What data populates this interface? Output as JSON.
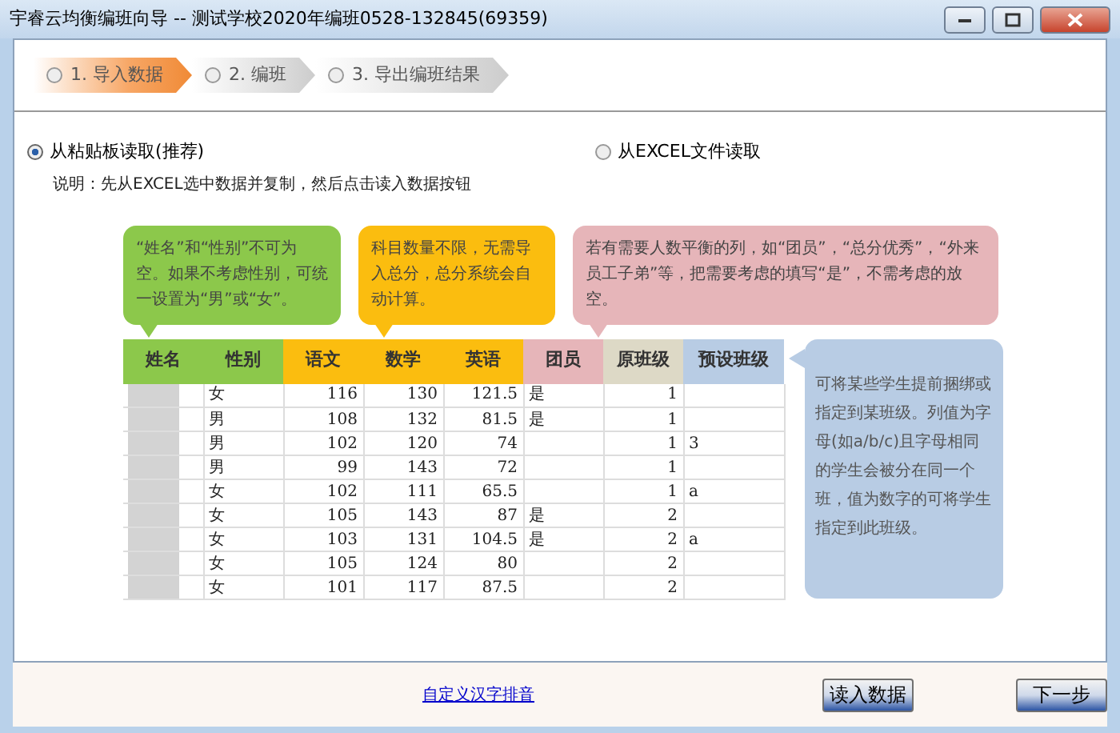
{
  "window": {
    "title": "宇睿云均衡编班向导 -- 测试学校2020年编班0528-132845(69359)"
  },
  "steps": [
    {
      "number": "1.",
      "label": "导入数据",
      "selected": true
    },
    {
      "number": "2.",
      "label": "编班",
      "selected": false
    },
    {
      "number": "3.",
      "label": "导出编班结果",
      "selected": false
    }
  ],
  "sources": [
    {
      "label": "从粘贴板读取(推荐)",
      "selected": true
    },
    {
      "label": "从EXCEL文件读取",
      "selected": false
    }
  ],
  "instruction": "说明：先从EXCEL选中数据并复制，然后点击读入数据按钮",
  "illustration": {
    "notes": [
      {
        "text": "“姓名”和“性别”不可为空。如果不考虑性别，可统一设置为“男”或“女”。",
        "color": "#8cc84b"
      },
      {
        "text": "科目数量不限，无需导入总分，总分系统会自动计算。",
        "color": "#fbbd0f"
      },
      {
        "text": "若有需要人数平衡的列，如“团员”，“总分优秀”，“外来员工子弟”等，把需要考虑的填写“是”，不需考虑的放空。",
        "color": "#e6b5b9"
      }
    ],
    "columns": [
      {
        "label": "姓名",
        "color": "#8cc84b"
      },
      {
        "label": "性别",
        "color": "#8cc84b"
      },
      {
        "label": "语文",
        "color": "#fbbd0f"
      },
      {
        "label": "数学",
        "color": "#fbbd0f"
      },
      {
        "label": "英语",
        "color": "#fbbd0f"
      },
      {
        "label": "团员",
        "color": "#e6b5b9"
      },
      {
        "label": "原班级",
        "color": "#ddd9c6"
      },
      {
        "label": "预设班级",
        "color": "#b8cce4"
      }
    ],
    "rows": [
      {
        "name_blurred": true,
        "cells": [
          "",
          "女",
          "116",
          "130",
          "121.5",
          "是",
          "1",
          ""
        ]
      },
      {
        "name_blurred": true,
        "cells": [
          "",
          "男",
          "108",
          "132",
          "81.5",
          "是",
          "1",
          ""
        ]
      },
      {
        "name_blurred": true,
        "cells": [
          "",
          "男",
          "102",
          "120",
          "74",
          "",
          "1",
          "3"
        ]
      },
      {
        "name_blurred": true,
        "cells": [
          "",
          "男",
          "99",
          "143",
          "72",
          "",
          "1",
          ""
        ]
      },
      {
        "name_blurred": true,
        "cells": [
          "",
          "女",
          "102",
          "111",
          "65.5",
          "",
          "1",
          "a"
        ]
      },
      {
        "name_blurred": true,
        "cells": [
          "",
          "女",
          "105",
          "143",
          "87",
          "是",
          "2",
          ""
        ]
      },
      {
        "name_blurred": true,
        "cells": [
          "",
          "女",
          "103",
          "131",
          "104.5",
          "是",
          "2",
          "a"
        ]
      },
      {
        "name_blurred": true,
        "cells": [
          "",
          "女",
          "105",
          "124",
          "80",
          "",
          "2",
          ""
        ]
      },
      {
        "name_blurred": true,
        "cells": [
          "",
          "女",
          "101",
          "117",
          "87.5",
          "",
          "2",
          ""
        ]
      }
    ],
    "side_note": {
      "text": "可将某些学生提前捆绑或指定到某班级。列值为字母(如a/b/c)且字母相同的学生会被分在同一个班，值为数字的可将学生指定到此班级。",
      "color": "#b8cce4"
    }
  },
  "footer": {
    "link": "自定义汉字排音",
    "buttons": [
      "读入数据",
      "下一步"
    ]
  }
}
